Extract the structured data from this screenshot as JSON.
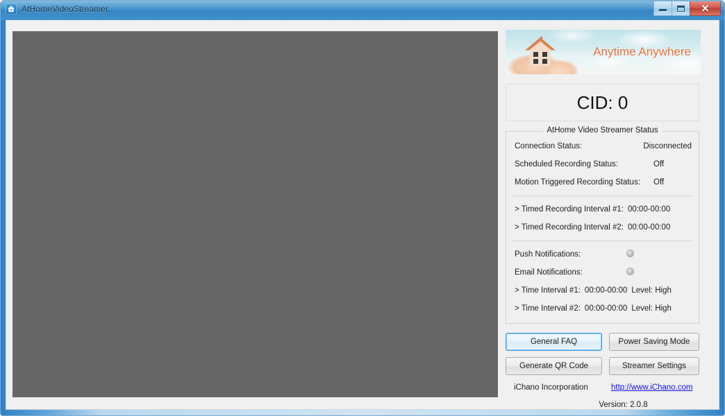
{
  "window": {
    "title": "AtHomeVideoStreamer",
    "app_icon": "house-wifi-icon",
    "controls": {
      "minimize": "minimize-icon",
      "maximize": "maximize-icon",
      "close": "✕"
    }
  },
  "video": {
    "preview_label": ""
  },
  "banner": {
    "tagline": "Anytime Anywhere",
    "image": "house-in-hands-sky-photo",
    "tagline_color": "#e8733f"
  },
  "cid": {
    "text": "CID: 0"
  },
  "status": {
    "group_title": "AtHome Video Streamer Status",
    "rows": [
      {
        "label": "Connection Status:",
        "value": "Disconnected"
      },
      {
        "label": "Scheduled Recording Status:",
        "value": "Off"
      },
      {
        "label": "Motion Triggered Recording Status:",
        "value": "Off"
      }
    ],
    "timed_recording": [
      {
        "label": "> Timed Recording Interval #1:",
        "value": "00:00-00:00"
      },
      {
        "label": "> Timed Recording Interval #2:",
        "value": "00:00-00:00"
      }
    ],
    "notifications": [
      {
        "label": "Push Notifications:",
        "indicator": "led-off"
      },
      {
        "label": "Email Notifications:",
        "indicator": "led-off"
      }
    ],
    "time_intervals": [
      {
        "label": "> Time Interval #1:",
        "value": "00:00-00:00",
        "level": "Level: High"
      },
      {
        "label": "> Time Interval #2:",
        "value": "00:00-00:00",
        "level": "Level: High"
      }
    ]
  },
  "buttons": {
    "general_faq": "General FAQ",
    "power_saving_mode": "Power Saving Mode",
    "generate_qr_code": "Generate QR Code",
    "streamer_settings": "Streamer Settings"
  },
  "footer": {
    "company": "iChano Incorporation",
    "website": "http://www.iChano.com",
    "version": "Version: 2.0.8"
  }
}
